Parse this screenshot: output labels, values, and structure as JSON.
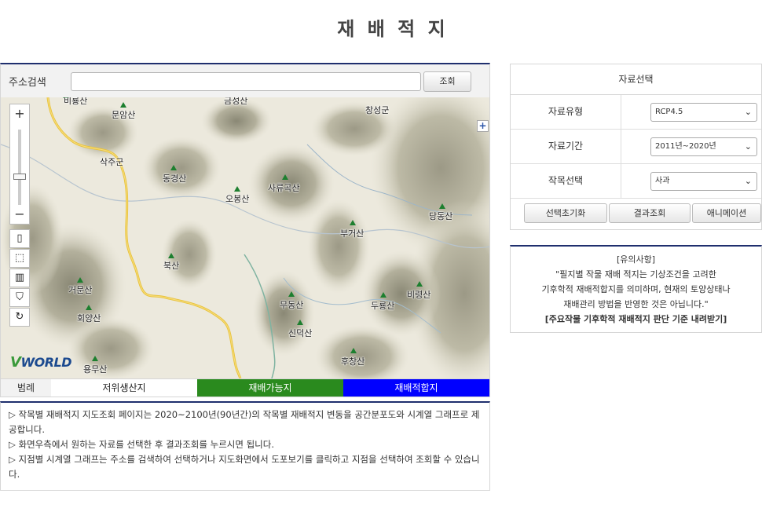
{
  "page": {
    "title": "재 배 적 지"
  },
  "search": {
    "label": "주소검색",
    "value": "",
    "placeholder": "",
    "button": "조회"
  },
  "map": {
    "zoom_in": "+",
    "zoom_out": "−",
    "expand": "+",
    "brand": "WORLD",
    "brand_v": "V",
    "places": [
      {
        "name": "비룡산",
        "kind": "peak"
      },
      {
        "name": "문암산",
        "kind": "peak"
      },
      {
        "name": "삭주군",
        "kind": "town"
      },
      {
        "name": "동경산",
        "kind": "peak"
      },
      {
        "name": "오봉산",
        "kind": "peak"
      },
      {
        "name": "사류곡산",
        "kind": "peak"
      },
      {
        "name": "창성군",
        "kind": "town"
      },
      {
        "name": "당동산",
        "kind": "peak"
      },
      {
        "name": "부거산",
        "kind": "peak"
      },
      {
        "name": "북산",
        "kind": "peak"
      },
      {
        "name": "거문산",
        "kind": "peak"
      },
      {
        "name": "회양산",
        "kind": "peak"
      },
      {
        "name": "무동산",
        "kind": "peak"
      },
      {
        "name": "두룡산",
        "kind": "peak"
      },
      {
        "name": "비령산",
        "kind": "peak"
      },
      {
        "name": "신덕산",
        "kind": "peak"
      },
      {
        "name": "후창산",
        "kind": "peak"
      },
      {
        "name": "용무산",
        "kind": "peak"
      },
      {
        "name": "금성산",
        "kind": "peak"
      }
    ]
  },
  "legend": {
    "label": "범례",
    "items": [
      {
        "label": "저위생산지",
        "color": "#ffffff",
        "text_color": "#222222"
      },
      {
        "label": "재배가능지",
        "color": "#2a8a1e",
        "text_color": "#ffffff"
      },
      {
        "label": "재배적합지",
        "color": "#0000ff",
        "text_color": "#ffffff"
      }
    ]
  },
  "description": [
    "▷ 작목별 재배적지 지도조회 페이지는 2020~2100년(90년간)의 작목별 재배적지 변동을 공간분포도와 시계열 그래프로 제공합니다.",
    "▷ 화면우측에서 원하는 자료를 선택한 후 결과조회를 누르시면 됩니다.",
    "▷ 지점별 시계열 그래프는 주소를 검색하여 선택하거나 지도화면에서 도포보기를 클릭하고 지점을 선택하여 조회할 수 있습니다."
  ],
  "panel": {
    "title": "자료선택",
    "rows": [
      {
        "label": "자료유형",
        "value": "RCP4.5"
      },
      {
        "label": "자료기간",
        "value": "2011년~2020년"
      },
      {
        "label": "작목선택",
        "value": "사과"
      }
    ],
    "buttons": [
      "선택초기화",
      "결과조회",
      "애니메이션"
    ]
  },
  "notice": {
    "title": "[유의사항]",
    "lines": [
      "\"필지별 작물 재배 적지는 기상조건을 고려한",
      "기후학적 재배적합지를 의미하며, 현재의 토양상태나",
      "재배관리 방법을 반영한 것은 아닙니다.\""
    ],
    "link": "[주요작물 기후학적 재배적지 판단 기준 내려받기]"
  }
}
